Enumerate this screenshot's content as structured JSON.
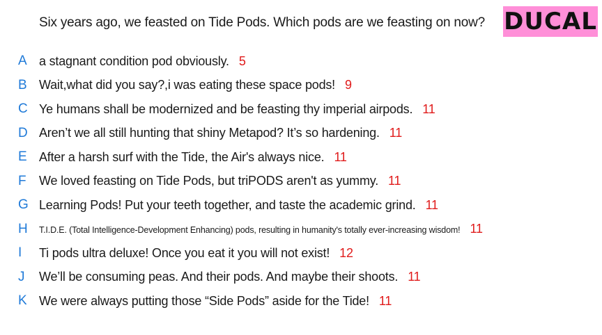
{
  "question": "Six years ago, we feasted on Tide Pods. Which pods are we feasting on now?",
  "badge": "DUCAL",
  "colors": {
    "letter": "#1f7ad8",
    "score": "#e01b1b",
    "badge_bg": "#ff8fd8"
  },
  "answers": [
    {
      "letter": "A",
      "text": "a stagnant condition pod obviously.",
      "score": "5"
    },
    {
      "letter": "B",
      "text": "Wait,what did you say?,i was eating these space pods!",
      "score": "9"
    },
    {
      "letter": "C",
      "text": "Ye humans shall be modernized and be feasting thy imperial airpods.",
      "score": "11"
    },
    {
      "letter": "D",
      "text": "Aren’t we all still hunting that shiny Metapod? It’s so hardening.",
      "score": "11"
    },
    {
      "letter": "E",
      "text": "After a harsh surf with the Tide, the Air's always nice.",
      "score": "11"
    },
    {
      "letter": "F",
      "text": "We loved feasting on Tide Pods, but triPODS aren't as yummy.",
      "score": "11"
    },
    {
      "letter": "G",
      "text": "Learning Pods! Put your teeth together, and taste the academic grind.",
      "score": "11"
    },
    {
      "letter": "H",
      "text": "T.I.D.E. (Total Intelligence-Development Enhancing) pods, resulting in humanity's totally ever-increasing wisdom!",
      "score": "11"
    },
    {
      "letter": "I",
      "text": "Ti pods ultra deluxe! Once you eat it you will not exist!",
      "score": "12"
    },
    {
      "letter": "J",
      "text": "We’ll be consuming peas. And their pods. And maybe their shoots.",
      "score": "11"
    },
    {
      "letter": "K",
      "text": "We were always putting those “Side Pods” aside for the Tide!",
      "score": "11"
    }
  ]
}
